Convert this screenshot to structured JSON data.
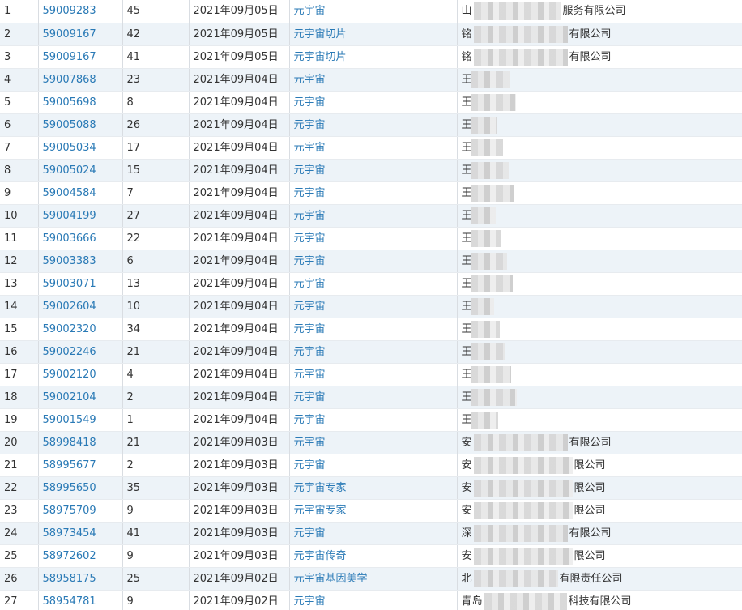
{
  "rows": [
    {
      "idx": "1",
      "reg_no": "59009283",
      "class": "45",
      "date": "2021年09月05日",
      "name": "元宇宙",
      "applicant_prefix": "山",
      "applicant_suffix": "服务有限公司"
    },
    {
      "idx": "2",
      "reg_no": "59009167",
      "class": "42",
      "date": "2021年09月05日",
      "name": "元宇宙切片",
      "applicant_prefix": "铭",
      "applicant_suffix": "有限公司"
    },
    {
      "idx": "3",
      "reg_no": "59009167",
      "class": "41",
      "date": "2021年09月05日",
      "name": "元宇宙切片",
      "applicant_prefix": "铭",
      "applicant_suffix": "有限公司"
    },
    {
      "idx": "4",
      "reg_no": "59007868",
      "class": "23",
      "date": "2021年09月04日",
      "name": "元宇宙",
      "applicant_prefix": "王",
      "applicant_suffix": ""
    },
    {
      "idx": "5",
      "reg_no": "59005698",
      "class": "8",
      "date": "2021年09月04日",
      "name": "元宇宙",
      "applicant_prefix": "王",
      "applicant_suffix": ""
    },
    {
      "idx": "6",
      "reg_no": "59005088",
      "class": "26",
      "date": "2021年09月04日",
      "name": "元宇宙",
      "applicant_prefix": "王",
      "applicant_suffix": ""
    },
    {
      "idx": "7",
      "reg_no": "59005034",
      "class": "17",
      "date": "2021年09月04日",
      "name": "元宇宙",
      "applicant_prefix": "王",
      "applicant_suffix": ""
    },
    {
      "idx": "8",
      "reg_no": "59005024",
      "class": "15",
      "date": "2021年09月04日",
      "name": "元宇宙",
      "applicant_prefix": "王",
      "applicant_suffix": ""
    },
    {
      "idx": "9",
      "reg_no": "59004584",
      "class": "7",
      "date": "2021年09月04日",
      "name": "元宇宙",
      "applicant_prefix": "王",
      "applicant_suffix": ""
    },
    {
      "idx": "10",
      "reg_no": "59004199",
      "class": "27",
      "date": "2021年09月04日",
      "name": "元宇宙",
      "applicant_prefix": "王",
      "applicant_suffix": ""
    },
    {
      "idx": "11",
      "reg_no": "59003666",
      "class": "22",
      "date": "2021年09月04日",
      "name": "元宇宙",
      "applicant_prefix": "王",
      "applicant_suffix": ""
    },
    {
      "idx": "12",
      "reg_no": "59003383",
      "class": "6",
      "date": "2021年09月04日",
      "name": "元宇宙",
      "applicant_prefix": "王",
      "applicant_suffix": ""
    },
    {
      "idx": "13",
      "reg_no": "59003071",
      "class": "13",
      "date": "2021年09月04日",
      "name": "元宇宙",
      "applicant_prefix": "王",
      "applicant_suffix": ""
    },
    {
      "idx": "14",
      "reg_no": "59002604",
      "class": "10",
      "date": "2021年09月04日",
      "name": "元宇宙",
      "applicant_prefix": "王",
      "applicant_suffix": ""
    },
    {
      "idx": "15",
      "reg_no": "59002320",
      "class": "34",
      "date": "2021年09月04日",
      "name": "元宇宙",
      "applicant_prefix": "王",
      "applicant_suffix": ""
    },
    {
      "idx": "16",
      "reg_no": "59002246",
      "class": "21",
      "date": "2021年09月04日",
      "name": "元宇宙",
      "applicant_prefix": "王",
      "applicant_suffix": ""
    },
    {
      "idx": "17",
      "reg_no": "59002120",
      "class": "4",
      "date": "2021年09月04日",
      "name": "元宇宙",
      "applicant_prefix": "王",
      "applicant_suffix": ""
    },
    {
      "idx": "18",
      "reg_no": "59002104",
      "class": "2",
      "date": "2021年09月04日",
      "name": "元宇宙",
      "applicant_prefix": "王",
      "applicant_suffix": ""
    },
    {
      "idx": "19",
      "reg_no": "59001549",
      "class": "1",
      "date": "2021年09月04日",
      "name": "元宇宙",
      "applicant_prefix": "王",
      "applicant_suffix": ""
    },
    {
      "idx": "20",
      "reg_no": "58998418",
      "class": "21",
      "date": "2021年09月03日",
      "name": "元宇宙",
      "applicant_prefix": "安",
      "applicant_suffix": "有限公司"
    },
    {
      "idx": "21",
      "reg_no": "58995677",
      "class": "2",
      "date": "2021年09月03日",
      "name": "元宇宙",
      "applicant_prefix": "安",
      "applicant_suffix": "限公司"
    },
    {
      "idx": "22",
      "reg_no": "58995650",
      "class": "35",
      "date": "2021年09月03日",
      "name": "元宇宙专家",
      "applicant_prefix": "安",
      "applicant_suffix": "限公司"
    },
    {
      "idx": "23",
      "reg_no": "58975709",
      "class": "9",
      "date": "2021年09月03日",
      "name": "元宇宙专家",
      "applicant_prefix": "安",
      "applicant_suffix": "限公司"
    },
    {
      "idx": "24",
      "reg_no": "58973454",
      "class": "41",
      "date": "2021年09月03日",
      "name": "元宇宙",
      "applicant_prefix": "深",
      "applicant_suffix": "有限公司"
    },
    {
      "idx": "25",
      "reg_no": "58972602",
      "class": "9",
      "date": "2021年09月03日",
      "name": "元宇宙传奇",
      "applicant_prefix": "安",
      "applicant_suffix": "限公司"
    },
    {
      "idx": "26",
      "reg_no": "58958175",
      "class": "25",
      "date": "2021年09月02日",
      "name": "元宇宙基因美学",
      "applicant_prefix": "北",
      "applicant_suffix": "有限责任公司"
    },
    {
      "idx": "27",
      "reg_no": "58954781",
      "class": "9",
      "date": "2021年09月02日",
      "name": "元宇宙",
      "applicant_prefix": "青岛",
      "applicant_suffix": "科技有限公司"
    }
  ],
  "colors": {
    "link": "#2a7ab6",
    "row_alt": "#edf3f8",
    "text": "#333333"
  }
}
